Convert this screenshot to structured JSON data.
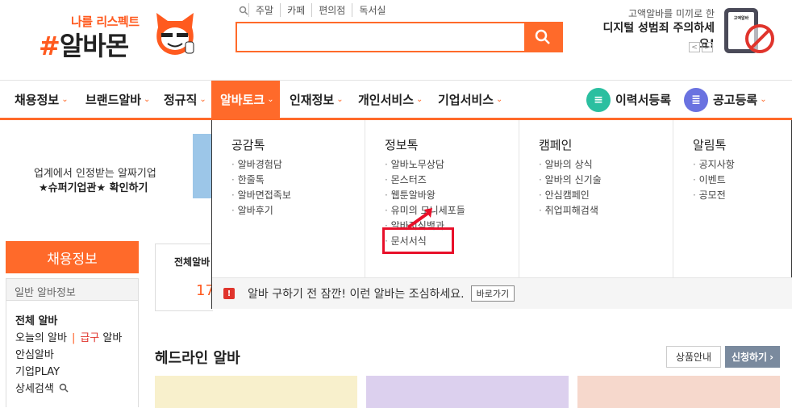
{
  "header": {
    "logo_sub": "나를 리스펙트",
    "logo_hash": "#",
    "logo_main": "알바몬",
    "quick_links": [
      "주말",
      "카페",
      "편의점",
      "독서실"
    ],
    "search_placeholder": "",
    "ad_line1": "고액알바를 미끼로 한",
    "ad_line2": "디지털 성범죄 주의하세요!",
    "ad_prev": "<",
    "ad_next": ">",
    "ad_phone_text": "고액알바"
  },
  "nav": {
    "items": [
      "채용정보",
      "브랜드알바",
      "정규직",
      "알바토크",
      "인재정보",
      "개인서비스",
      "기업서비스"
    ],
    "resume": "이력서등록",
    "post": "공고등록"
  },
  "promo": {
    "line1": "업계에서 인정받는 알짜기업",
    "line2": "★슈퍼기업관★ 확인하기"
  },
  "sidebar": {
    "button": "채용정보",
    "head": "일반 알바정보",
    "all": "전체 알바",
    "today": "오늘의 알바",
    "urgent": "급구",
    "urgent_suffix": "알바",
    "safe": "안심알바",
    "company": "기업PLAY",
    "detail": "상세검색"
  },
  "center": {
    "t1": "전체알바",
    "t2": "17"
  },
  "headline": {
    "title": "헤드라인 알바",
    "info_btn": "상품안내",
    "apply_btn": "신청하기"
  },
  "dropdown": {
    "columns": [
      {
        "title": "공감톡",
        "items": [
          "알바경험담",
          "한줄톡",
          "알바면접족보",
          "알바후기"
        ]
      },
      {
        "title": "정보톡",
        "items": [
          "알바노무상담",
          "몬스터즈",
          "웹툰알바왕",
          "유미의 모니세포들",
          "알바지식백과",
          "문서서식"
        ]
      },
      {
        "title": "캠페인",
        "items": [
          "알바의 상식",
          "알바의 신기술",
          "안심캠페인",
          "취업피해검색"
        ]
      },
      {
        "title": "알림톡",
        "items": [
          "공지사항",
          "이벤트",
          "공모전"
        ]
      }
    ],
    "warning": "알바 구하기 전 잠깐! 이런 알바는 조심하세요.",
    "warning_icon": "!",
    "go_btn": "바로가기"
  },
  "colors": {
    "brand": "#ff6a2a",
    "highlight": "#e8102a"
  }
}
